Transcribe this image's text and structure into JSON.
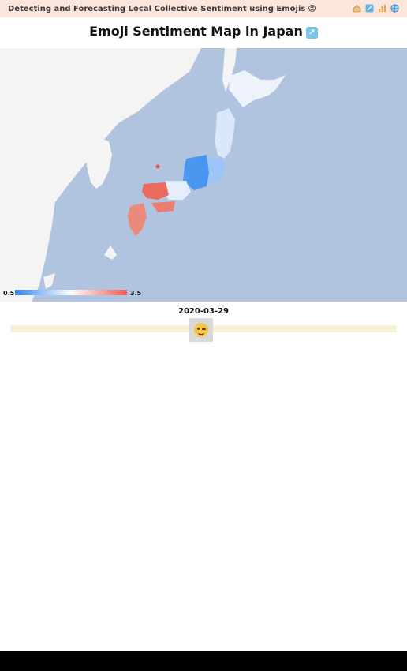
{
  "header": {
    "title": "Detecting and Forecasting Local Collective Sentiment using Emojis",
    "title_emoji": "😉",
    "nav_icons": [
      "home-emoji-icon",
      "map-emoji-icon",
      "chart-emoji-icon",
      "globe-emoji-icon"
    ]
  },
  "page": {
    "title": "Emoji Sentiment Map in Japan",
    "title_emoji_icon": "map-of-japan-icon"
  },
  "map": {
    "legend_min": "0.5",
    "legend_max": "3.5",
    "colors": {
      "low": "#2f86f0",
      "mid": "#ffffff",
      "high": "#ef5a50",
      "sea": "#b0c4df",
      "land": "#f4f4f4"
    }
  },
  "timeline": {
    "date": "2020-03-29",
    "handle_emoji": "winking-face-icon"
  }
}
